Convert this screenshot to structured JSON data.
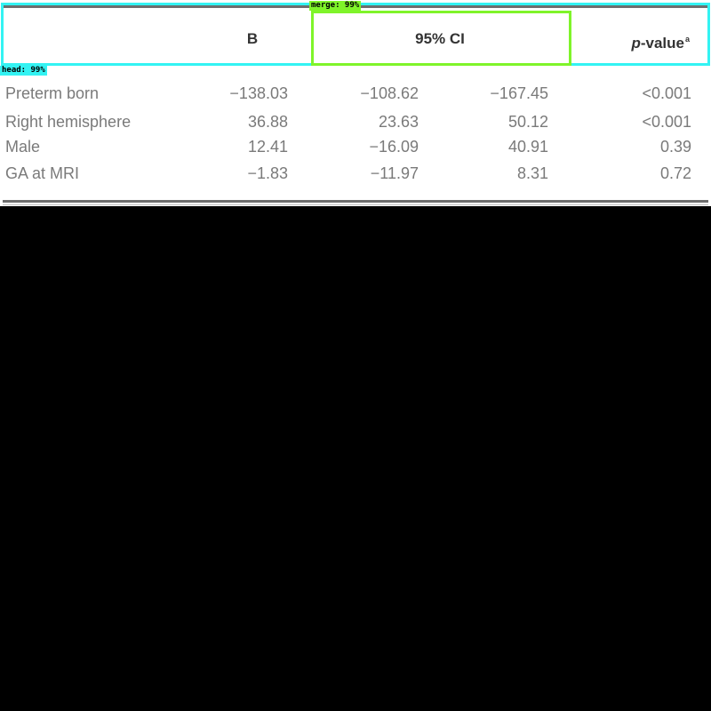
{
  "table": {
    "header": {
      "col_b": "B",
      "col_ci": "95% CI",
      "col_p": "p",
      "col_p_rest": "-value",
      "col_p_sup": "a"
    },
    "rows": [
      {
        "label": "Preterm born",
        "b": "−138.03",
        "ci_low": "−108.62",
        "ci_high": "−167.45",
        "p": "<0.001"
      },
      {
        "label": "Right hemisphere",
        "b": "36.88",
        "ci_low": "23.63",
        "ci_high": "50.12",
        "p": "<0.001"
      },
      {
        "label": "Male",
        "b": "12.41",
        "ci_low": "−16.09",
        "ci_high": "40.91",
        "p": "0.39"
      },
      {
        "label": "GA at MRI",
        "b": "−1.83",
        "ci_low": "−11.97",
        "ci_high": "8.31",
        "p": "0.72"
      }
    ]
  },
  "detections": {
    "head": {
      "label": "head: 99%",
      "color": "#33f3f3"
    },
    "merge": {
      "label": "merge: 99%",
      "color": "#7ff42a"
    }
  }
}
